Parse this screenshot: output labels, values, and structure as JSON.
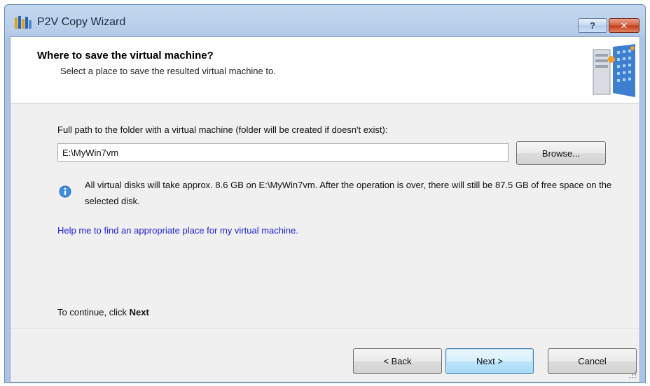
{
  "window": {
    "title": "P2V Copy Wizard",
    "help_label": "?",
    "close_label": "✕",
    "colors": {
      "frame": "#b6cde9",
      "close": "#c23a16",
      "link": "#2121d6"
    }
  },
  "header": {
    "title": "Where to save the virtual machine?",
    "subtitle": "Select a place to save the resulted virtual machine to."
  },
  "form": {
    "path_label": "Full path to the folder with a virtual machine (folder will be created if doesn't exist):",
    "path_value": "E:\\MyWin7vm",
    "browse_label": "Browse...",
    "info_text": "All virtual disks will take approx. 8.6 GB on E:\\MyWin7vm. After the operation is over, there will still be 87.5 GB of free space on the selected disk.",
    "help_link": "Help me to find an appropriate place for my virtual machine."
  },
  "footer": {
    "continue_prefix": "To continue, click ",
    "continue_bold": "Next",
    "back_label": "< Back",
    "next_label": "Next >",
    "cancel_label": "Cancel"
  },
  "icons": [
    "app-wizard-icon",
    "help-icon",
    "close-icon",
    "server-illustration-icon",
    "info-icon",
    "resize-grip-icon"
  ]
}
